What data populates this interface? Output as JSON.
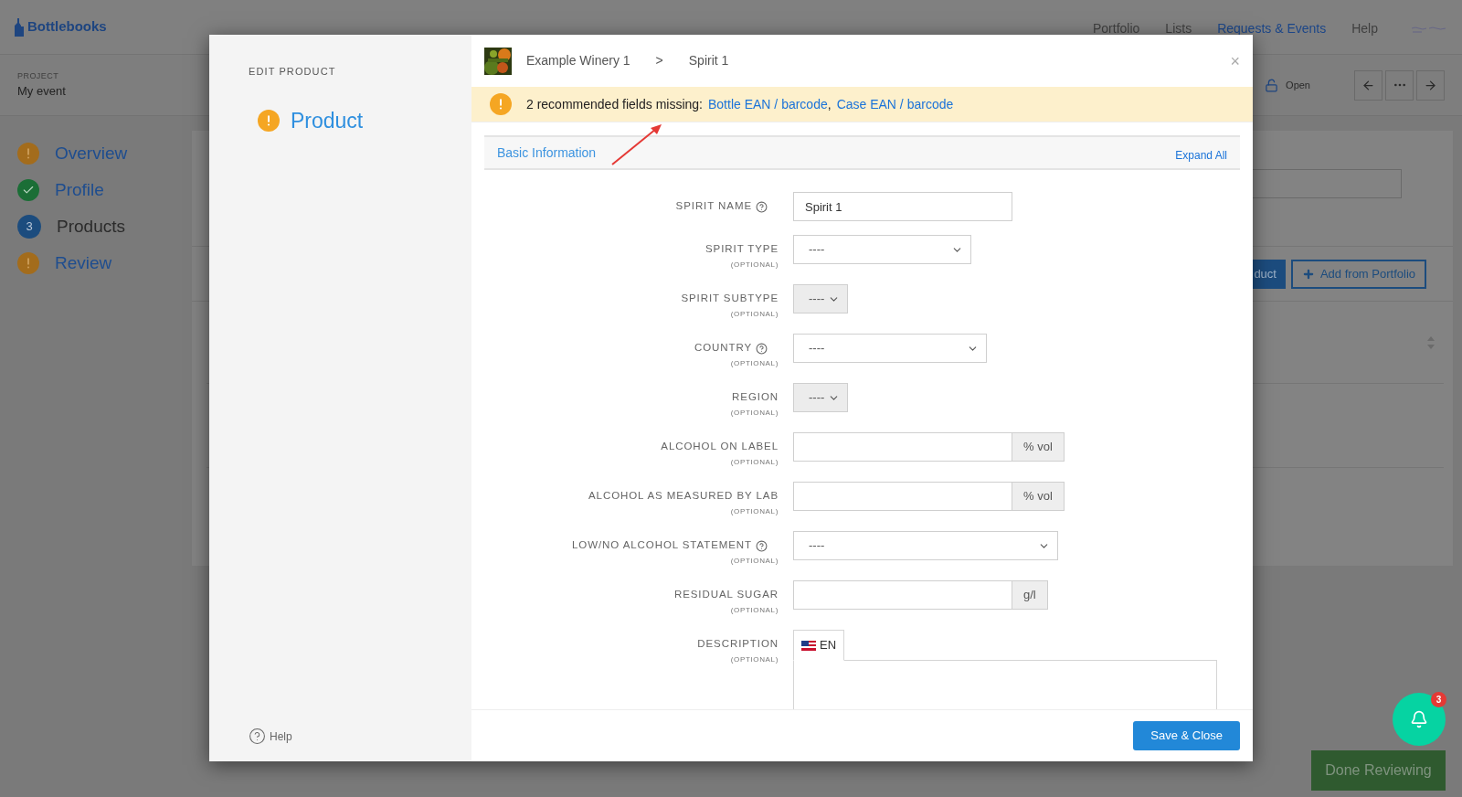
{
  "app": {
    "logo": "Bottlebooks",
    "nav": [
      {
        "label": "Portfolio",
        "selected": false
      },
      {
        "label": "Lists",
        "selected": false
      },
      {
        "label": "Requests & Events",
        "selected": true
      },
      {
        "label": "Help",
        "selected": false
      }
    ]
  },
  "project": {
    "label": "PROJECT",
    "name": "My event"
  },
  "toolbar": {
    "lock_label": "Open"
  },
  "steps": [
    {
      "label": "Overview",
      "kind": "warning",
      "selected": false
    },
    {
      "label": "Profile",
      "kind": "done",
      "selected": false
    },
    {
      "label": "Products",
      "kind": "count",
      "count": "3",
      "selected": true
    },
    {
      "label": "Review",
      "kind": "warning",
      "selected": false
    }
  ],
  "background": {
    "buttons": [
      {
        "label": "duct",
        "kind": "primary"
      },
      {
        "label": "Add from Portfolio",
        "kind": "outline"
      }
    ]
  },
  "notifications": {
    "count": "3"
  },
  "done_button": "Done Reviewing",
  "modal": {
    "title": "EDIT PRODUCT",
    "steps": [
      {
        "label": "Product",
        "kind": "warning"
      }
    ],
    "help": "Help",
    "breadcrumb": [
      "Example Winery 1",
      "Spirit 1"
    ],
    "breadcrumb_separator": ">",
    "close": "×",
    "banner": {
      "text": "2 recommended fields missing:",
      "links": [
        "Bottle EAN / barcode",
        "Case EAN / barcode"
      ],
      "separator": ","
    },
    "section": {
      "title": "Basic Information",
      "action": "Expand All"
    },
    "fields": [
      {
        "label": "SPIRIT NAME",
        "help": true,
        "kind": "text",
        "value": "Spirit 1"
      },
      {
        "label": "SPIRIT TYPE",
        "help": false,
        "note": "(OPTIONAL)",
        "kind": "select",
        "value": "----",
        "disabled": false
      },
      {
        "label": "SPIRIT SUBTYPE",
        "help": false,
        "note": "(OPTIONAL)",
        "kind": "select",
        "value": "----",
        "disabled": true
      },
      {
        "label": "COUNTRY",
        "help": true,
        "note": "(OPTIONAL)",
        "kind": "select",
        "value": "----",
        "disabled": false
      },
      {
        "label": "REGION",
        "help": false,
        "note": "(OPTIONAL)",
        "kind": "select",
        "value": "----",
        "disabled": true
      },
      {
        "label": "ALCOHOL ON LABEL",
        "help": false,
        "note": "(OPTIONAL)",
        "kind": "unit",
        "unit": "% vol"
      },
      {
        "label": "ALCOHOL AS MEASURED BY LAB",
        "help": false,
        "note": "(OPTIONAL)",
        "kind": "unit",
        "unit": "% vol"
      },
      {
        "label": "LOW/NO ALCOHOL STATEMENT",
        "help": true,
        "note": "(OPTIONAL)",
        "kind": "select",
        "value": "----",
        "disabled": false
      },
      {
        "label": "RESIDUAL SUGAR",
        "help": false,
        "note": "(OPTIONAL)",
        "kind": "unit",
        "unit": "g/l"
      },
      {
        "label": "DESCRIPTION",
        "help": false,
        "note": "(OPTIONAL)",
        "kind": "textarea",
        "tabs": [
          {
            "label": "EN",
            "selected": true
          }
        ]
      }
    ],
    "save": "Save & Close"
  }
}
